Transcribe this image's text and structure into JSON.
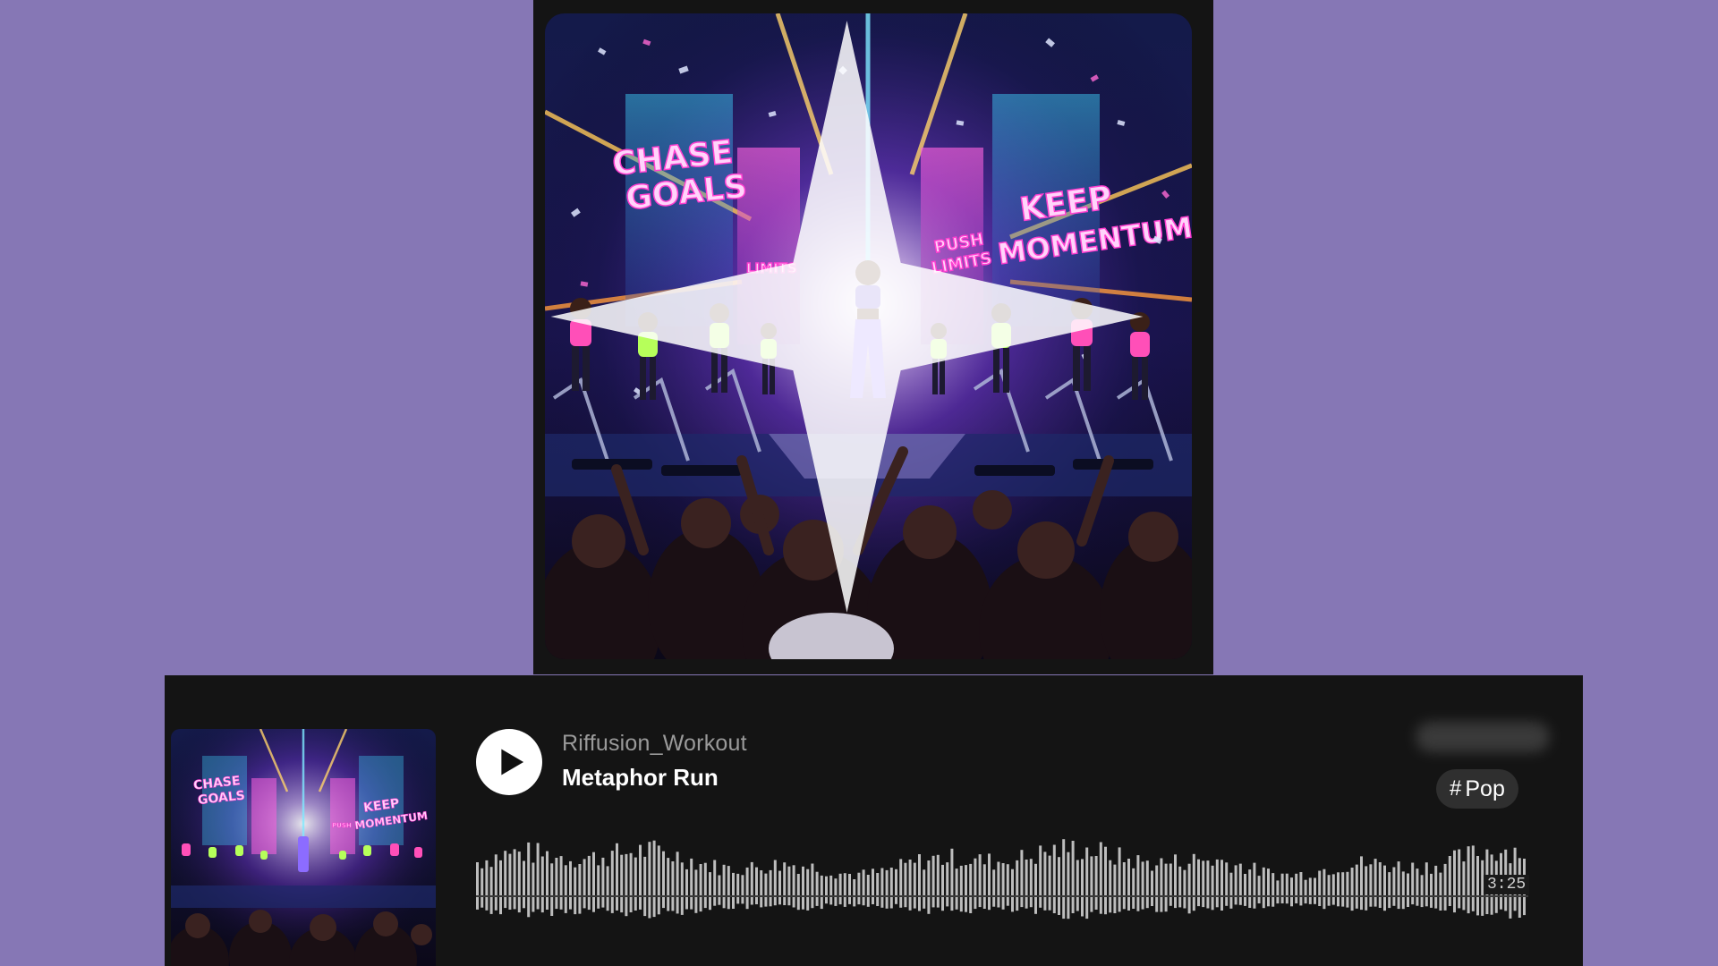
{
  "track": {
    "artist": "Riffusion_Workout",
    "title": "Metaphor Run",
    "duration": "3:25",
    "genre_tag": "Pop",
    "tag_prefix": "#"
  },
  "artwork": {
    "signs": [
      "CHASE GOALS",
      "KEEP MOMENTUM",
      "PUSH LIMITS",
      "LIMITS"
    ],
    "badge_icon": "sparkle-icon"
  },
  "player": {
    "play_icon": "play-icon",
    "playback_progress": 0
  },
  "colors": {
    "background": "#8677b5",
    "card": "#141414",
    "waveform": "#bdbdbd",
    "tag_bg": "#2f2f2f",
    "neon_pink": "#ff4fd8",
    "neon_cyan": "#38d7ff",
    "neon_green": "#b6ff5a"
  }
}
